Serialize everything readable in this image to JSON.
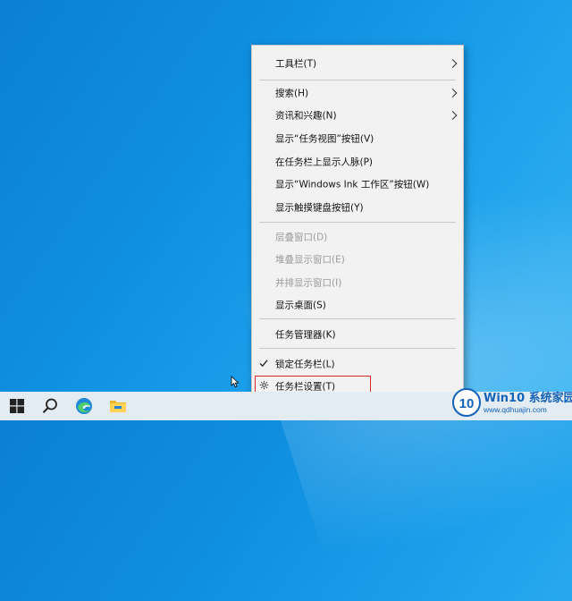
{
  "menu": {
    "items": [
      {
        "label": "工具栏(T)",
        "submenu": true,
        "disabled": false
      },
      {
        "label": "搜索(H)",
        "submenu": true,
        "disabled": false
      },
      {
        "label": "资讯和兴趣(N)",
        "submenu": true,
        "disabled": false
      },
      {
        "label": "显示“任务视图”按钮(V)",
        "submenu": false,
        "disabled": false
      },
      {
        "label": "在任务栏上显示人脉(P)",
        "submenu": false,
        "disabled": false
      },
      {
        "label": "显示“Windows Ink 工作区”按钮(W)",
        "submenu": false,
        "disabled": false
      },
      {
        "label": "显示触摸键盘按钮(Y)",
        "submenu": false,
        "disabled": false
      },
      {
        "label": "层叠窗口(D)",
        "submenu": false,
        "disabled": true
      },
      {
        "label": "堆叠显示窗口(E)",
        "submenu": false,
        "disabled": true
      },
      {
        "label": "并排显示窗口(I)",
        "submenu": false,
        "disabled": true
      },
      {
        "label": "显示桌面(S)",
        "submenu": false,
        "disabled": false
      },
      {
        "label": "任务管理器(K)",
        "submenu": false,
        "disabled": false
      },
      {
        "label": "锁定任务栏(L)",
        "submenu": false,
        "disabled": false,
        "checked": true
      },
      {
        "label": "任务栏设置(T)",
        "submenu": false,
        "disabled": false,
        "icon": "gear-icon",
        "highlighted": true
      }
    ]
  },
  "taskbar": {
    "buttons": [
      {
        "name": "start-button",
        "icon": "windows-logo-icon"
      },
      {
        "name": "search-button",
        "icon": "search-icon"
      },
      {
        "name": "edge-button",
        "icon": "edge-icon"
      },
      {
        "name": "file-explorer-button",
        "icon": "folder-icon"
      }
    ]
  },
  "watermark": {
    "badge": "10",
    "title": "Win10 系统家园",
    "url": "www.qdhuajin.com"
  },
  "colors": {
    "desktop": "#0f8fe0",
    "menu_bg": "#f2f2f2",
    "highlight_border": "#d42a2a",
    "taskbar": "#e3ecf2"
  }
}
